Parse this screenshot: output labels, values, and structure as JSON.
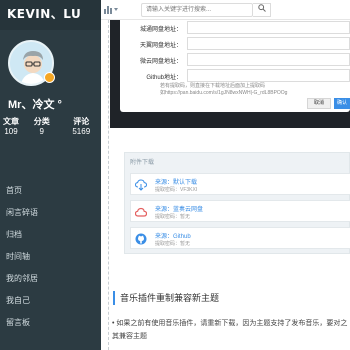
{
  "sidebar": {
    "logo": "KEVIN、LU",
    "username": "Mr、冷文 °",
    "stats": [
      {
        "label": "文章",
        "value": "109"
      },
      {
        "label": "分类",
        "value": "9"
      },
      {
        "label": "评论",
        "value": "5169"
      }
    ],
    "nav": [
      {
        "label": "首页"
      },
      {
        "label": "闲言碎语"
      },
      {
        "label": "归档"
      },
      {
        "label": "时间轴"
      },
      {
        "label": "我的邻居"
      },
      {
        "label": "我自己"
      },
      {
        "label": "留言板"
      }
    ]
  },
  "topbar": {
    "search_placeholder": "请输入关键字进行搜索...",
    "search_icon": "search-icon",
    "chart_icon": "bar-chart-icon"
  },
  "modal": {
    "fields": [
      {
        "label": "城通网盘地址："
      },
      {
        "label": "天翼网盘地址："
      },
      {
        "label": "微云网盘地址："
      },
      {
        "label": "Github地址："
      }
    ],
    "hint_line1": "若有提取码，则直接在下载地址后面加上提取码",
    "hint_line2": "如https://pan.baidu.com/s/1gJN8wxNWH|-G_rdL8BPOOg",
    "cancel_label": "取消",
    "ok_label": "确认"
  },
  "download": {
    "title": "附件下载",
    "items": [
      {
        "name": "来源：默认下载",
        "code": "提取密码：VF3KXI",
        "icon": "cloud-download-icon",
        "icon_color": "#3a8ee6"
      },
      {
        "name": "来源：蓝奏云网盘",
        "code": "提取密码：暂无",
        "icon": "cloud-icon",
        "icon_color": "#e45f5f"
      },
      {
        "name": "来源：Github",
        "code": "提取密码：暂无",
        "icon": "github-icon",
        "icon_color": "#3a8ee6"
      }
    ]
  },
  "article": {
    "heading": "音乐插件重制兼容新主题",
    "body_line1": "• 如果之前有使用音乐插件，请重新下载，因为主题支持了发布音乐，要对之",
    "body_line2": "其兼容主题"
  }
}
